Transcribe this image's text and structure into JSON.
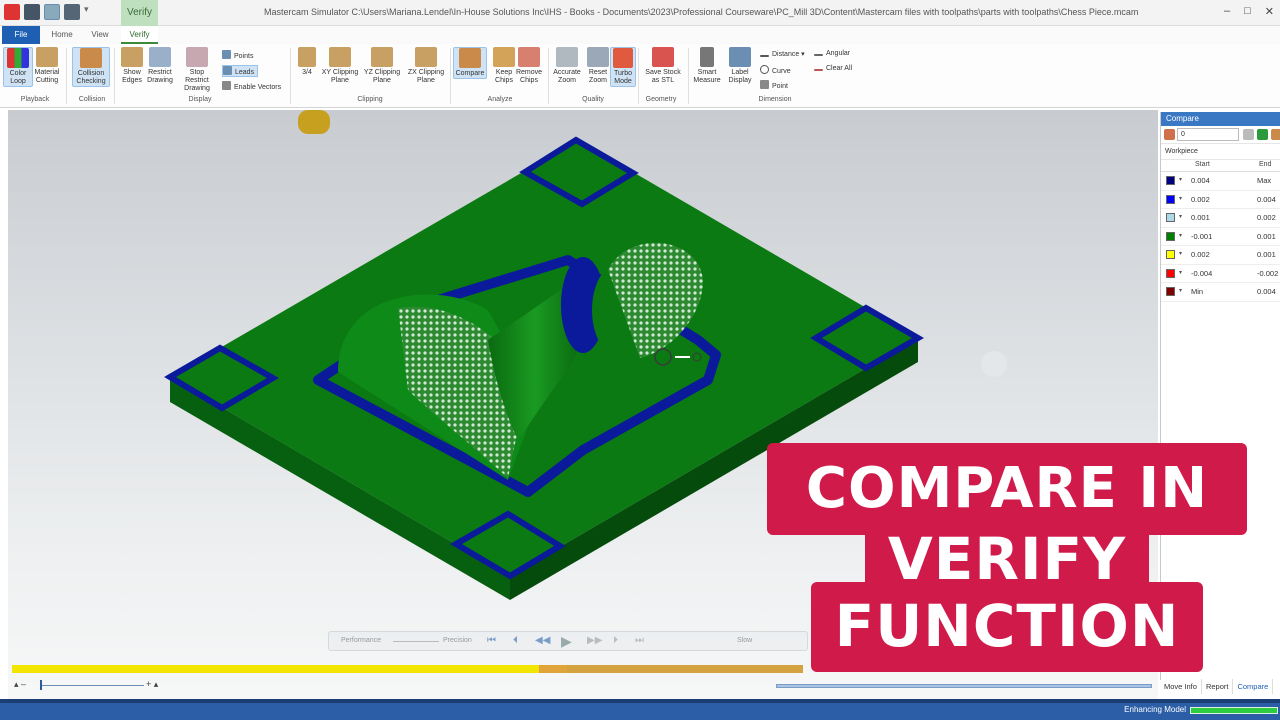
{
  "window": {
    "title": "Mastercam Simulator  C:\\Users\\Mariana.Lendel\\In-House Solutions Inc\\IHS - Books - Documents\\2023\\Professional Courseware\\PC_Mill 3D\\Content\\Mastercam files with toolpaths\\parts with toolpaths\\Chess Piece.mcam",
    "contextual_tab": "Verify",
    "controls": [
      "–",
      "□",
      "✕"
    ]
  },
  "tabs": [
    "File",
    "Home",
    "View",
    "Verify"
  ],
  "ribbon": {
    "groups": {
      "playback": "Playback",
      "collision": "Collision",
      "display": "Display",
      "clipping": "Clipping",
      "analyze": "Analyze",
      "quality": "Quality",
      "geometry": "Geometry",
      "dimension": "Dimension"
    },
    "buttons": {
      "color_loop": "Color Loop",
      "material_cutting": "Material Cutting",
      "collision_checking": "Collision Checking",
      "show_edges": "Show Edges",
      "restrict_drawing": "Restrict Drawing",
      "stop_restrict_drawing": "Stop Restrict Drawing",
      "points": "Points",
      "leads": "Leads",
      "enable_vectors": "Enable Vectors",
      "three_quarter": "3/4",
      "xy_clipping": "XY Clipping Plane",
      "yz_clipping": "YZ Clipping Plane",
      "zx_clipping": "ZX Clipping Plane",
      "compare": "Compare",
      "keep_chips": "Keep Chips",
      "remove_chips": "Remove Chips",
      "accurate_zoom": "Accurate Zoom",
      "reset_zoom": "Reset Zoom",
      "turbo_mode": "Turbo Mode",
      "save_stock": "Save Stock as STL",
      "smart_measure": "Smart Measure",
      "label_display": "Label Display",
      "distance": "Distance",
      "curve": "Curve",
      "point": "Point",
      "angular": "Angular",
      "clear_all": "Clear All"
    }
  },
  "compare_panel": {
    "title": "Compare",
    "value_field": "0",
    "workpiece": "Workpiece",
    "col_start": "Start",
    "col_end": "End",
    "rows": [
      {
        "color": "#000080",
        "start": "0.004",
        "end": "Max"
      },
      {
        "color": "#0000ff",
        "start": "0.002",
        "end": "0.004"
      },
      {
        "color": "#add8e6",
        "start": "0.001",
        "end": "0.002"
      },
      {
        "color": "#008000",
        "start": "-0.001",
        "end": "0.001"
      },
      {
        "color": "#ffff00",
        "start": "0.002",
        "end": "0.001"
      },
      {
        "color": "#ff0000",
        "start": "-0.004",
        "end": "-0.002"
      },
      {
        "color": "#800000",
        "start": "Min",
        "end": "0.004"
      }
    ]
  },
  "playback": {
    "performance": "Performance",
    "precision": "Precision",
    "slow": "Slow",
    "controls": [
      "⏮",
      "⏴",
      "◀◀",
      "▶",
      "▶▶",
      "⏵",
      "⏭"
    ]
  },
  "progress": {
    "played_fraction": 0.46,
    "total_fraction": 0.69
  },
  "bottom_tabs": [
    "Move Info",
    "Report",
    "Compare"
  ],
  "status": {
    "text": "Enhancing Model"
  },
  "banner": {
    "line1": "COMPARE IN",
    "line2": "VERIFY",
    "line3": "FUNCTION"
  },
  "colors": {
    "part_green": "#0b7a12",
    "part_blue": "#0a1a9a",
    "banner": "#d01a4a",
    "accent": "#1e5fb4"
  }
}
